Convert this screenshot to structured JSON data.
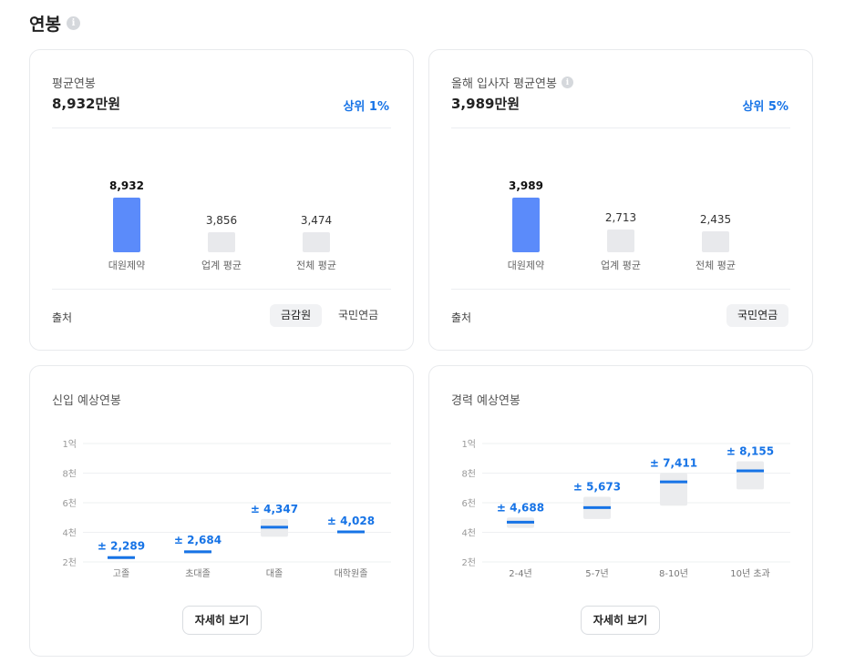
{
  "page": {
    "title": "연봉"
  },
  "avg_card": {
    "label": "평균연봉",
    "value": "8,932만원",
    "rank": "상위 1%",
    "bars": [
      {
        "label": "대원제약",
        "value": 8932,
        "value_text": "8,932",
        "highlight": true
      },
      {
        "label": "업계 평균",
        "value": 3856,
        "value_text": "3,856",
        "highlight": false
      },
      {
        "label": "전체 평균",
        "value": 3474,
        "value_text": "3,474",
        "highlight": false
      }
    ],
    "source_label": "출처",
    "sources": [
      "금감원",
      "국민연금"
    ],
    "active_source": "금감원"
  },
  "newhire_card": {
    "label": "올해 입사자 평균연봉",
    "value": "3,989만원",
    "rank": "상위 5%",
    "bars": [
      {
        "label": "대원제약",
        "value": 3989,
        "value_text": "3,989",
        "highlight": true
      },
      {
        "label": "업계 평균",
        "value": 2713,
        "value_text": "2,713",
        "highlight": false
      },
      {
        "label": "전체 평균",
        "value": 2435,
        "value_text": "2,435",
        "highlight": false
      }
    ],
    "source_label": "출처",
    "sources": [
      "국민연금"
    ],
    "active_source": "국민연금"
  },
  "chart_data": [
    {
      "type": "range",
      "title": "신입 예상연봉",
      "y_ticks": [
        "1억",
        "8천",
        "6천",
        "4천",
        "2천"
      ],
      "ylim": [
        2000,
        10000
      ],
      "categories": [
        "고졸",
        "초대졸",
        "대졸",
        "대학원졸"
      ],
      "values": [
        2289,
        2684,
        4347,
        4028
      ],
      "value_labels": [
        "± 2,289",
        "± 2,684",
        "± 4,347",
        "± 4,028"
      ],
      "ranges": [
        [
          2180,
          2400
        ],
        [
          2560,
          2800
        ],
        [
          3700,
          4900
        ],
        [
          3950,
          4100
        ]
      ],
      "accent": "#1673e6"
    },
    {
      "type": "range",
      "title": "경력 예상연봉",
      "y_ticks": [
        "1억",
        "8천",
        "6천",
        "4천",
        "2천"
      ],
      "ylim": [
        2000,
        10000
      ],
      "categories": [
        "2-4년",
        "5-7년",
        "8-10년",
        "10년 초과"
      ],
      "values": [
        4688,
        5673,
        7411,
        8155
      ],
      "value_labels": [
        "± 4,688",
        "± 5,673",
        "± 7,411",
        "± 8,155"
      ],
      "ranges": [
        [
          4300,
          5000
        ],
        [
          4900,
          6400
        ],
        [
          5800,
          8000
        ],
        [
          6900,
          8800
        ]
      ],
      "accent": "#1673e6"
    }
  ],
  "detail_button": {
    "label": "자세히 보기"
  }
}
